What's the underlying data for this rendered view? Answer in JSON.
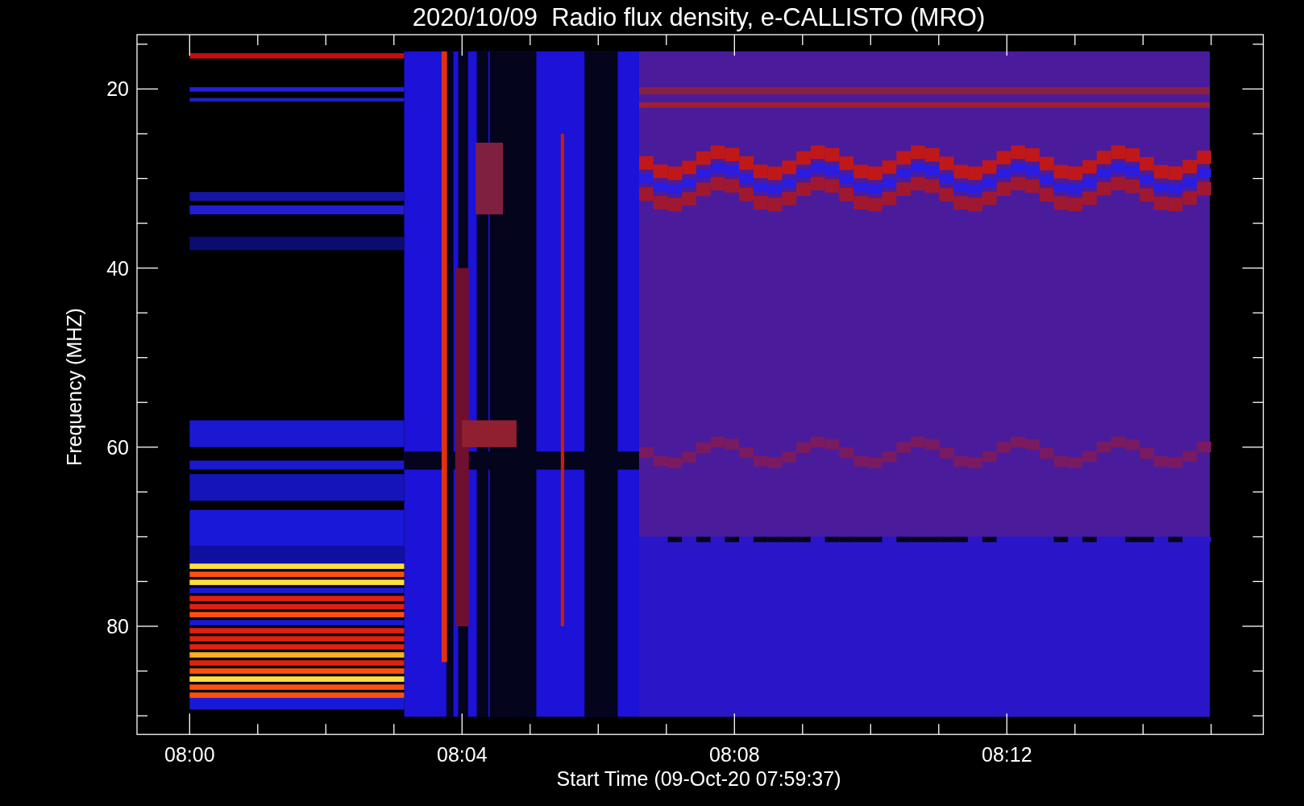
{
  "plot": {
    "title": "2020/10/09  Radio flux density, e-CALLISTO (MRO)",
    "ylabel": "Frequency (MHZ)",
    "xlabel": "Start Time (09-Oct-20 07:59:37)",
    "yticks": [
      "20",
      "40",
      "60",
      "80"
    ],
    "xticks": [
      "08:00",
      "08:04",
      "08:08",
      "08:12"
    ]
  }
}
